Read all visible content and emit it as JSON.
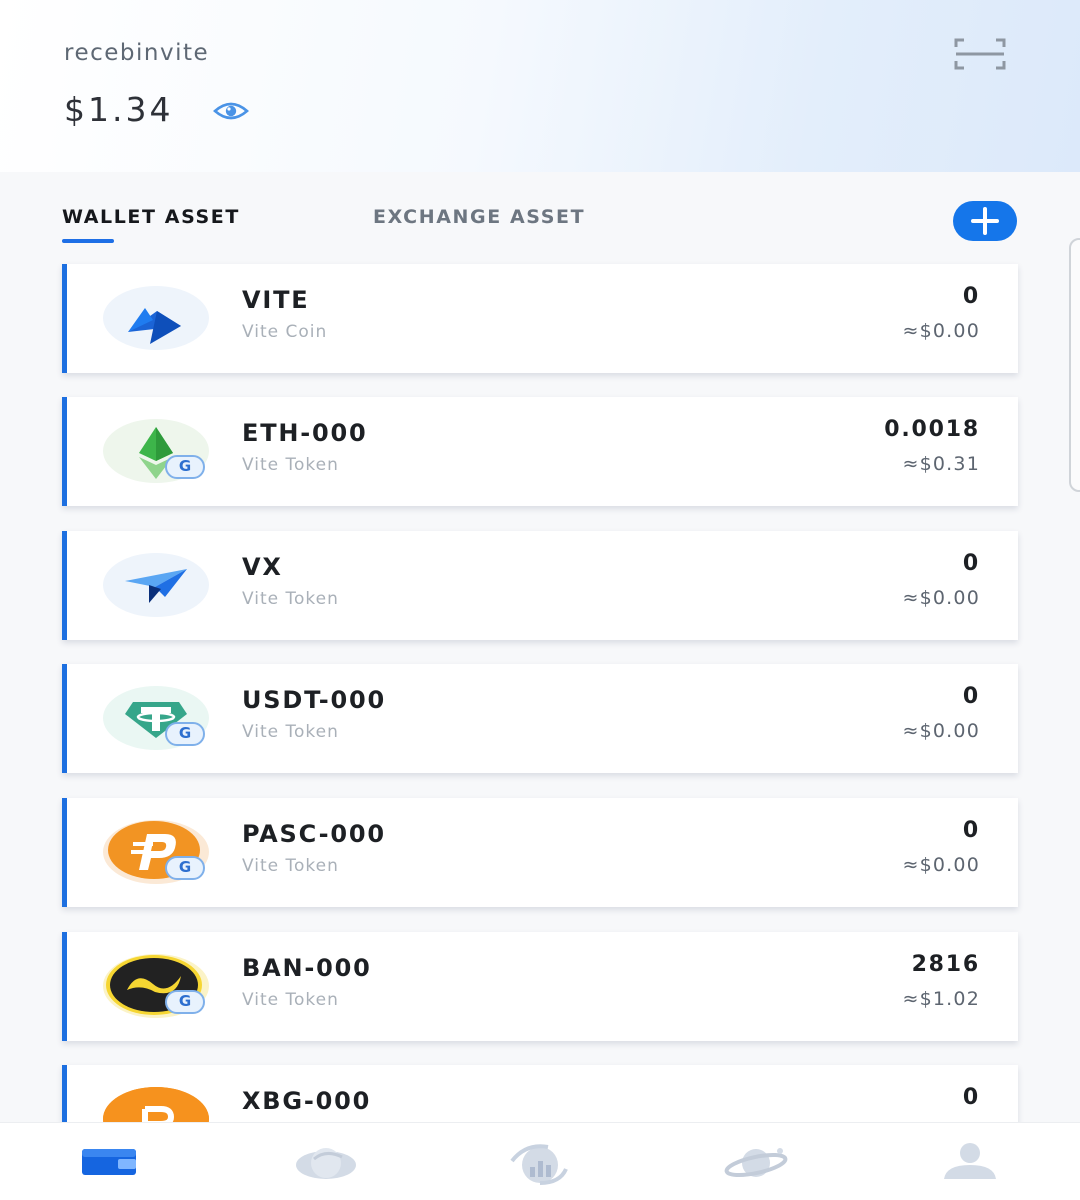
{
  "header": {
    "account_name": "recebinvite",
    "balance": "$1.34"
  },
  "tabs": {
    "wallet": "WALLET ASSET",
    "exchange": "EXCHANGE ASSET",
    "active": "wallet"
  },
  "assets": [
    {
      "symbol": "VITE",
      "type": "Vite Coin",
      "amount": "0",
      "fiat": "≈$0.00",
      "icon": "vite-logo-icon",
      "gateway_badge": ""
    },
    {
      "symbol": "ETH-000",
      "type": "Vite Token",
      "amount": "0.0018",
      "fiat": "≈$0.31",
      "icon": "eth-logo-icon",
      "gateway_badge": "G"
    },
    {
      "symbol": "VX",
      "type": "Vite Token",
      "amount": "0",
      "fiat": "≈$0.00",
      "icon": "vx-logo-icon",
      "gateway_badge": ""
    },
    {
      "symbol": "USDT-000",
      "type": "Vite Token",
      "amount": "0",
      "fiat": "≈$0.00",
      "icon": "usdt-logo-icon",
      "gateway_badge": "G"
    },
    {
      "symbol": "PASC-000",
      "type": "Vite Token",
      "amount": "0",
      "fiat": "≈$0.00",
      "icon": "pasc-logo-icon",
      "gateway_badge": "G"
    },
    {
      "symbol": "BAN-000",
      "type": "Vite Token",
      "amount": "2816",
      "fiat": "≈$1.02",
      "icon": "ban-logo-icon",
      "gateway_badge": "G"
    },
    {
      "symbol": "XBG-000",
      "type": "",
      "amount": "0",
      "fiat": "",
      "icon": "xbg-logo-icon",
      "gateway_badge": ""
    }
  ],
  "bottom_nav": [
    {
      "icon": "wallet-icon",
      "active": true
    },
    {
      "icon": "explore-icon",
      "active": false
    },
    {
      "icon": "exchange-chart-icon",
      "active": false
    },
    {
      "icon": "planet-icon",
      "active": false
    },
    {
      "icon": "profile-icon",
      "active": false
    }
  ],
  "colors": {
    "accent": "#1576ea",
    "card_border": "#1d6fe0",
    "inactive_nav": "#d3dbe6"
  }
}
